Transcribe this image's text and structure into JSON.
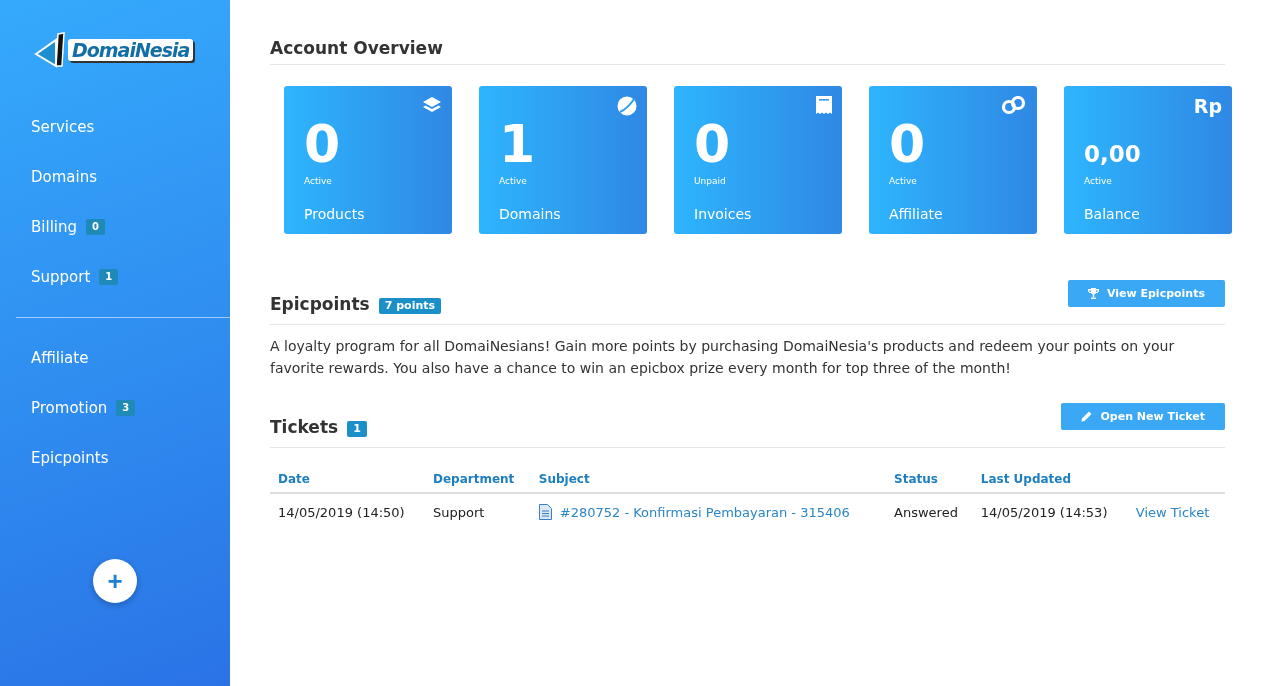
{
  "logo": {
    "text": "DomaiNesia"
  },
  "sidebar": {
    "sections": [
      {
        "items": [
          {
            "label": "Services"
          },
          {
            "label": "Domains"
          },
          {
            "label": "Billing",
            "badge": "0"
          },
          {
            "label": "Support",
            "badge": "1"
          }
        ]
      },
      {
        "items": [
          {
            "label": "Affiliate"
          },
          {
            "label": "Promotion",
            "badge": "3"
          },
          {
            "label": "Epicpoints"
          }
        ]
      }
    ],
    "add_button": {
      "label": "+"
    }
  },
  "overview": {
    "title": "Account Overview",
    "cards": [
      {
        "kind": "layers",
        "value": "0",
        "caption": "Active",
        "label": "Products"
      },
      {
        "kind": "globe",
        "value": "1",
        "caption": "Active",
        "label": "Domains"
      },
      {
        "kind": "receipt",
        "value": "0",
        "caption": "Unpaid",
        "label": "Invoices"
      },
      {
        "kind": "link",
        "value": "0",
        "caption": "Active",
        "label": "Affiliate"
      },
      {
        "kind": "currency",
        "icon_text": "Rp",
        "value": "0,00",
        "caption": "Active",
        "label": "Balance"
      }
    ]
  },
  "epicpoints": {
    "title": "Epicpoints",
    "badge": "7 points",
    "button": "View Epicpoints",
    "description": "A loyalty program for all DomaiNesians! Gain more points by purchasing DomaiNesia's products and redeem your points on your favorite rewards. You also have a chance to win an epicbox prize every month for top three of the month!"
  },
  "tickets": {
    "title": "Tickets",
    "badge": "1",
    "button": "Open New Ticket",
    "table": {
      "columns": [
        "Date",
        "Department",
        "Subject",
        "Status",
        "Last Updated"
      ],
      "rows": [
        {
          "date": "14/05/2019 (14:50)",
          "department": "Support",
          "subject": "#280752 - Konfirmasi Pembayaran - 315406",
          "status": "Answered",
          "last_updated": "14/05/2019 (14:53)",
          "action": "View Ticket"
        }
      ]
    }
  }
}
